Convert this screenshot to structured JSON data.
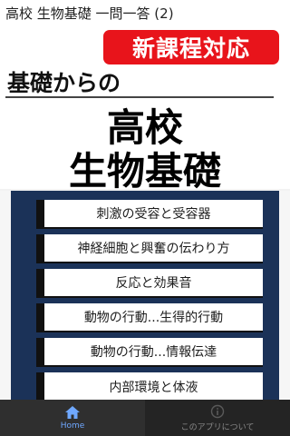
{
  "app": {
    "title": "高校 生物基礎 一問一答 (2)"
  },
  "hero": {
    "badge": "新課程対応",
    "subtitle": "基礎からの",
    "title_line1": "高校",
    "title_line2": "生物基礎"
  },
  "menu": {
    "items": [
      {
        "label": "刺激の受容と受容器"
      },
      {
        "label": "神経細胞と興奮の伝わり方"
      },
      {
        "label": "反応と効果音"
      },
      {
        "label": "動物の行動...生得的行動"
      },
      {
        "label": "動物の行動...情報伝達"
      },
      {
        "label": "内部環境と体液"
      }
    ]
  },
  "nav": {
    "home": {
      "label": "Home",
      "icon": "home-icon"
    },
    "about": {
      "label": "このアプリについて",
      "icon": "info-icon"
    }
  },
  "colors": {
    "badge": "#e8141b",
    "menu_background": "#1b3258",
    "nav_background": "#242424",
    "nav_active": "#6fa8ff"
  }
}
